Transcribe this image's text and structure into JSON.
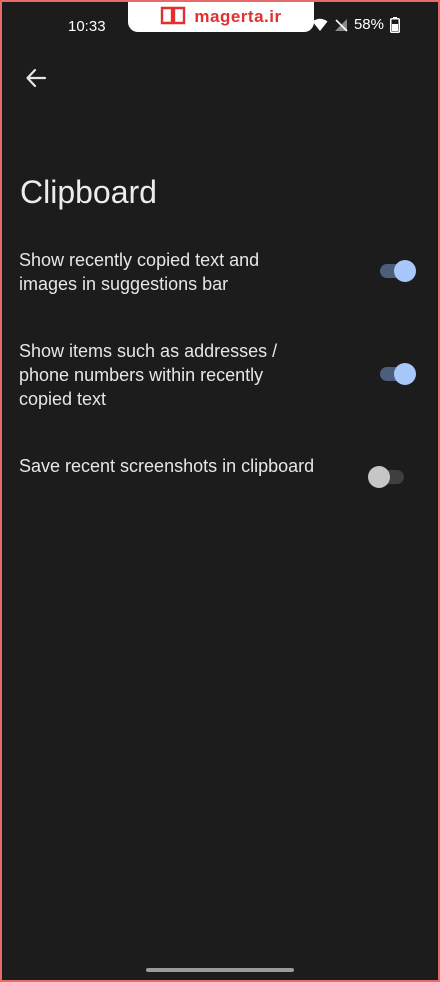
{
  "status_bar": {
    "time": "10:33",
    "battery": "58%",
    "watermark": "magerta.ir"
  },
  "header": {
    "back_icon": "arrow-left-icon",
    "title": "Clipboard"
  },
  "settings": [
    {
      "label": "Show recently copied text and images in suggestions bar",
      "enabled": true
    },
    {
      "label": "Show items such as addresses / phone numbers within recently copied text",
      "enabled": true
    },
    {
      "label": "Save recent screenshots in clipboard",
      "enabled": false
    }
  ],
  "colors": {
    "background": "#1c1c1d",
    "toggle_on_thumb": "#a8c7fa",
    "toggle_on_track": "#4b5f7b",
    "toggle_off_thumb": "#c6c6c6",
    "frame_border": "#e86a6a",
    "watermark_accent": "#e0302f"
  }
}
